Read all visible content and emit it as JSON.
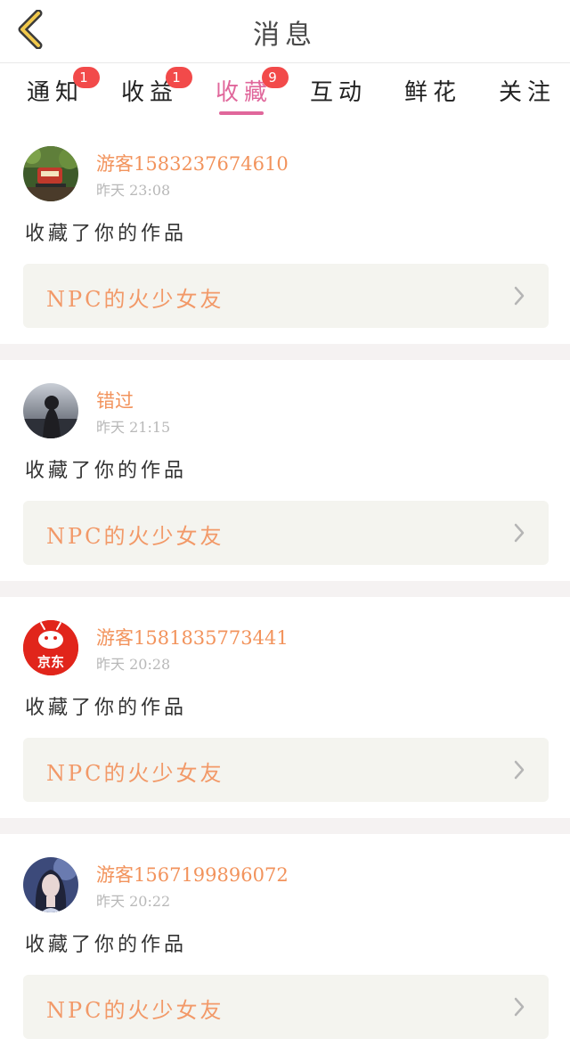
{
  "header": {
    "title": "消息",
    "back_icon": "chevron-left-icon"
  },
  "tabs": [
    {
      "label": "通知",
      "badge": "1"
    },
    {
      "label": "收益",
      "badge": "1"
    },
    {
      "label": "收藏",
      "badge": "9",
      "active": true
    },
    {
      "label": "互动"
    },
    {
      "label": "鲜花"
    },
    {
      "label": "关注"
    }
  ],
  "colors": {
    "accent": "#e0679b",
    "username": "#f2935c",
    "badge": "#f24a4a",
    "work_bg": "#f4f4ef"
  },
  "messages": [
    {
      "user": "游客1583237674610",
      "time": "昨天 23:08",
      "action": "收藏了你的作品",
      "work": "NPC的火少女友",
      "avatar": "train-photo-avatar"
    },
    {
      "user": "错过",
      "time": "昨天 21:15",
      "action": "收藏了你的作品",
      "work": "NPC的火少女友",
      "avatar": "girl-silhouette-avatar"
    },
    {
      "user": "游客1581835773441",
      "time": "昨天 20:28",
      "action": "收藏了你的作品",
      "work": "NPC的火少女友",
      "avatar": "jd-logo-avatar",
      "avatar_text": "京东"
    },
    {
      "user": "游客1567199896072",
      "time": "昨天 20:22",
      "action": "收藏了你的作品",
      "work": "NPC的火少女友",
      "avatar": "portrait-avatar"
    }
  ]
}
